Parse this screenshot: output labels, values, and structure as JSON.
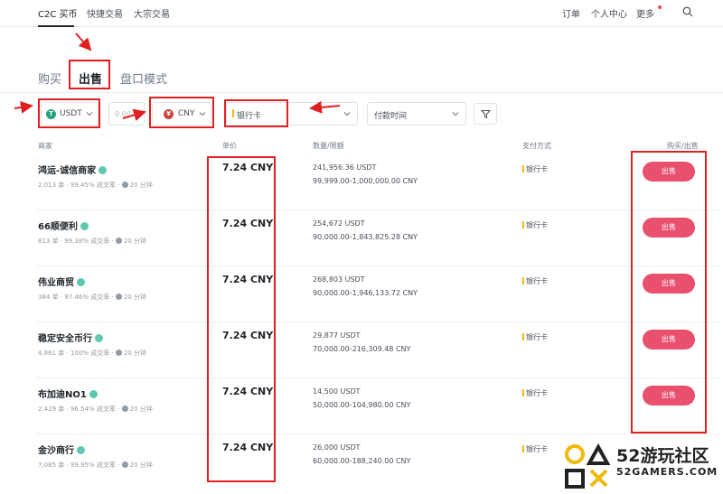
{
  "topnav": {
    "items": [
      "C2C 买币",
      "快捷交易",
      "大宗交易"
    ],
    "right_items": [
      "订单",
      "个人中心",
      "更多"
    ],
    "search_icon": "search-icon"
  },
  "tabs": {
    "buy": "购买",
    "sell": "出售",
    "mode": "盘口模式"
  },
  "filters": {
    "crypto": "USDT",
    "amount_placeholder": "0.00",
    "fiat": "CNY",
    "fiat_symbol": "¥",
    "payment": "银行卡",
    "time": "付款时间"
  },
  "table": {
    "headers": [
      "商家",
      "单价",
      "数量/限额",
      "支付方式",
      "购买/出售"
    ]
  },
  "rows": [
    {
      "merchant": "鸿运-诚信商家",
      "orders": "2,013 单",
      "completion": "99.45% 成交率",
      "time": "20 分钟",
      "price": "7.24 CNY",
      "available": "241,956.36 USDT",
      "limit": "99,999.00-1,000,000.00 CNY",
      "payment": "银行卡",
      "action": "出售"
    },
    {
      "merchant": "66顺便利",
      "orders": "813 单",
      "completion": "99.38% 成交率",
      "time": "20 分钟",
      "price": "7.24 CNY",
      "available": "254,672 USDT",
      "limit": "90,000.00-1,843,825.28 CNY",
      "payment": "银行卡",
      "action": "出售"
    },
    {
      "merchant": "伟业商贸",
      "orders": "384 单",
      "completion": "97.46% 成交率",
      "time": "20 分钟",
      "price": "7.24 CNY",
      "available": "268,803 USDT",
      "limit": "90,000.00-1,946,133.72 CNY",
      "payment": "银行卡",
      "action": "出售"
    },
    {
      "merchant": "稳定安全币行",
      "orders": "4,861 单",
      "completion": "100% 成交率",
      "time": "20 分钟",
      "price": "7.24 CNY",
      "available": "29,877 USDT",
      "limit": "70,000.00-216,309.48 CNY",
      "payment": "银行卡",
      "action": "出售"
    },
    {
      "merchant": "布加迪NO1",
      "orders": "2,429 单",
      "completion": "96.54% 成交率",
      "time": "20 分钟",
      "price": "7.24 CNY",
      "available": "14,500 USDT",
      "limit": "50,000.00-104,980.00 CNY",
      "payment": "银行卡",
      "action": "出售"
    },
    {
      "merchant": "金沙商行",
      "orders": "7,085 单",
      "completion": "99.95% 成交率",
      "time": "20 分钟",
      "price": "7.24 CNY",
      "available": "26,000 USDT",
      "limit": "60,000.00-188,240.00 CNY",
      "payment": "银行卡",
      "action": null
    }
  ],
  "colors": {
    "sell_button": "#e8506e",
    "annotation": "#e02020",
    "usdt": "#26a17b",
    "cny": "#c9463d"
  },
  "watermark": {
    "cn": "52游玩社区",
    "en": "52GAMERS.COM"
  }
}
